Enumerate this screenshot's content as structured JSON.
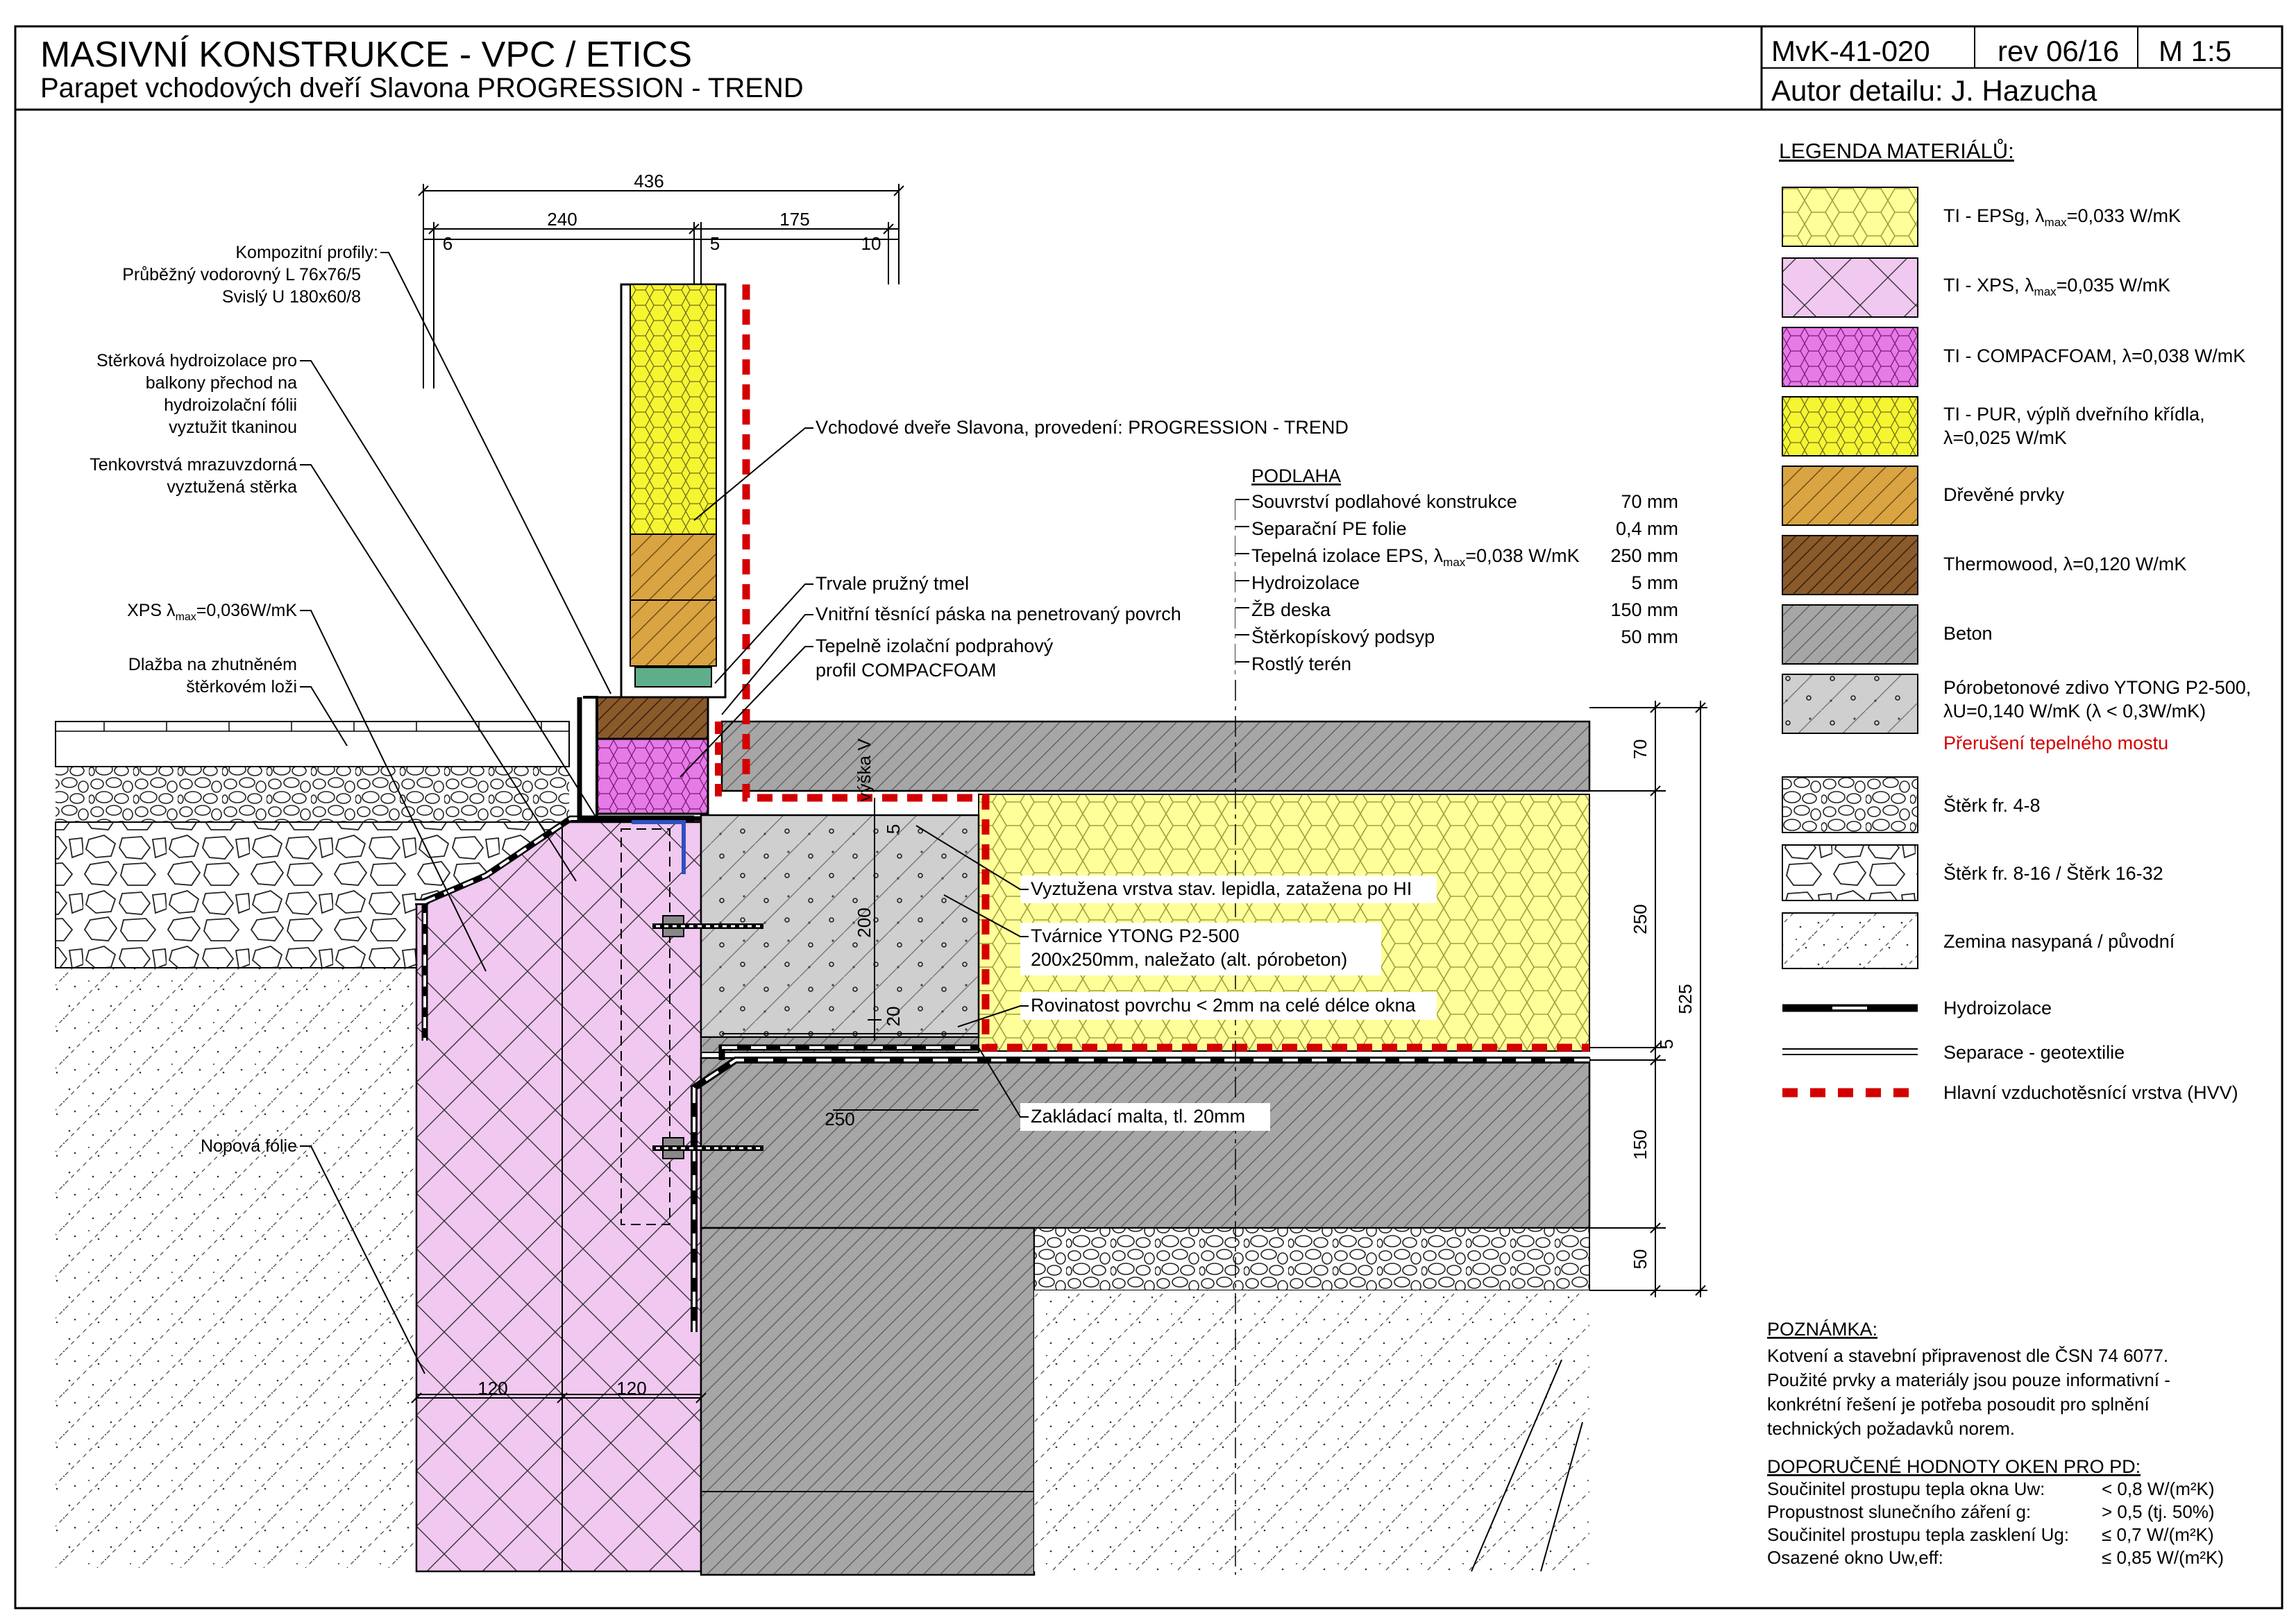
{
  "header": {
    "title": "MASIVNÍ KONSTRUKCE - VPC / ETICS",
    "subtitle": "Parapet vchodových dveří Slavona PROGRESSION - TREND",
    "code": "MvK-41-020",
    "revision": "rev 06/16",
    "scale": "M 1:5",
    "author": "Autor detailu: J. Hazucha"
  },
  "dimensions": {
    "d436": "436",
    "d240": "240",
    "d175": "175",
    "d6": "6",
    "d5": "5",
    "d10": "10",
    "d70": "70",
    "d250": "250",
    "d525": "525",
    "d5b": "5",
    "d150": "150",
    "d50": "50",
    "d_200": "200",
    "d_20": "20",
    "d_5c": "5",
    "d_250b": "250",
    "d120a": "120",
    "d120b": "120",
    "vyska": "výška V"
  },
  "left_labels": {
    "kompozit": [
      "Kompozitní profily:",
      "Průběžný vodorovný  L 76x76/5",
      "Svislý U 180x60/8"
    ],
    "sterkova": [
      "Stěrková hydroizolace pro",
      "balkony přechod na",
      "hydroizolační fólii",
      "vyztužit tkaninou"
    ],
    "tenkovrstva": [
      "Tenkovrstvá mrazuvzdorná",
      "vyztužená stěrka"
    ],
    "xps_pre": "XPS  λ",
    "xps_sub": "max",
    "xps_post": "=0,036W/mK",
    "dlazba": [
      "Dlažba na zhutněném",
      "štěrkovém loži"
    ],
    "nopova": "Nopová fólie"
  },
  "center_labels": {
    "dvere": "Vchodové dveře Slavona, provedení: PROGRESSION - TREND",
    "tmel": "Trvale pružný tmel",
    "paska": "Vnitřní těsnící páska na penetrovaný povrch",
    "profil": [
      "Tepelně izolační podprahový",
      "profil COMPACFOAM"
    ],
    "vrstva": "Vyztužena vrstva stav. lepidla, zatažena po HI",
    "tvarnice": [
      "Tvárnice YTONG P2-500",
      "200x250mm, naležato (alt. pórobeton)"
    ],
    "rovinatost": "Rovinatost povrchu < 2mm na celé délce okna",
    "malta": "Zakládací malta, tl. 20mm"
  },
  "floor": {
    "heading": "PODLAHA",
    "rows": [
      {
        "name": "Souvrství podlahové konstrukce",
        "value": "70 mm"
      },
      {
        "name": "Separační PE folie",
        "value": "0,4 mm"
      },
      {
        "name": "Tepelná izolace EPS, λ",
        "sub": "max",
        "post": "=0,038 W/mK",
        "value": "250 mm"
      },
      {
        "name": "Hydroizolace",
        "value": "5 mm"
      },
      {
        "name": "ŽB deska",
        "value": "150 mm"
      },
      {
        "name": "Štěrkopískový podsyp",
        "value": "50 mm"
      },
      {
        "name": "Rostlý terén",
        "value": ""
      }
    ]
  },
  "legend": {
    "title": "LEGENDA MATERIÁLŮ:",
    "items": [
      {
        "id": "epsg",
        "pre": "TI - EPSg, λ",
        "sub": "max",
        "post": "=0,033 W/mK"
      },
      {
        "id": "xps",
        "pre": "TI - XPS, λ",
        "sub": "max",
        "post": "=0,035 W/mK"
      },
      {
        "id": "compac",
        "pre": "TI - COMPACFOAM, λ=0,038 W/mK"
      },
      {
        "id": "pur",
        "lines": [
          "TI - PUR,  výplň dveřního křídla,",
          "λ=0,025 W/mK"
        ]
      },
      {
        "id": "wood",
        "pre": "Dřevěné prvky"
      },
      {
        "id": "thermo",
        "pre": "Thermowood, λ=0,120 W/mK"
      },
      {
        "id": "beton",
        "pre": "Beton"
      },
      {
        "id": "ytong",
        "lines": [
          "Pórobetonové zdivo  YTONG P2-500,",
          "λU=0,140 W/mK (λ < 0,3W/mK)"
        ],
        "extra": "Přerušení tepelného mostu"
      },
      {
        "id": "sterk48",
        "pre": "Štěrk fr. 4-8"
      },
      {
        "id": "sterk816",
        "pre": "Štěrk fr. 8-16 / Štěrk 16-32"
      },
      {
        "id": "zemina",
        "pre": "Zemina nasypaná / původní"
      },
      {
        "id": "hydro",
        "pre": "Hydroizolace"
      },
      {
        "id": "separace",
        "pre": "Separace - geotextilie"
      },
      {
        "id": "hvv",
        "pre": "Hlavní vzduchotěsnící vrstva (HVV)"
      }
    ]
  },
  "note": {
    "title": "POZNÁMKA:",
    "lines": [
      "Kotvení a stavební připravenost dle ČSN 74 6077.",
      "Použité prvky a materiály jsou pouze informativní -",
      "konkrétní řešení je potřeba posoudit pro splnění",
      "technických požadavků norem."
    ]
  },
  "recommended": {
    "title": "DOPORUČENÉ HODNOTY OKEN PRO PD:",
    "rows": [
      {
        "name": "Součinitel prostupu tepla okna Uw:",
        "value": "< 0,8 W/(m²K)"
      },
      {
        "name": "Propustnost slunečního záření g:",
        "value": "> 0,5 (tj. 50%)"
      },
      {
        "name": "Součinitel prostupu tepla zasklení Ug:",
        "value": "≤ 0,7 W/(m²K)"
      },
      {
        "name": "Osazené okno Uw,eff:",
        "value": "≤ 0,85 W/(m²K)"
      }
    ]
  },
  "colors": {
    "eps": "#ffff99",
    "xps": "#f0c8f0",
    "compac": "#e67ae6",
    "wood": "#d9a441",
    "thermo": "#8b5a2b",
    "beton": "#a6a6a6",
    "ytong": "#cfcfcf",
    "hvv": "#d40000",
    "note_red": "#d40000"
  }
}
